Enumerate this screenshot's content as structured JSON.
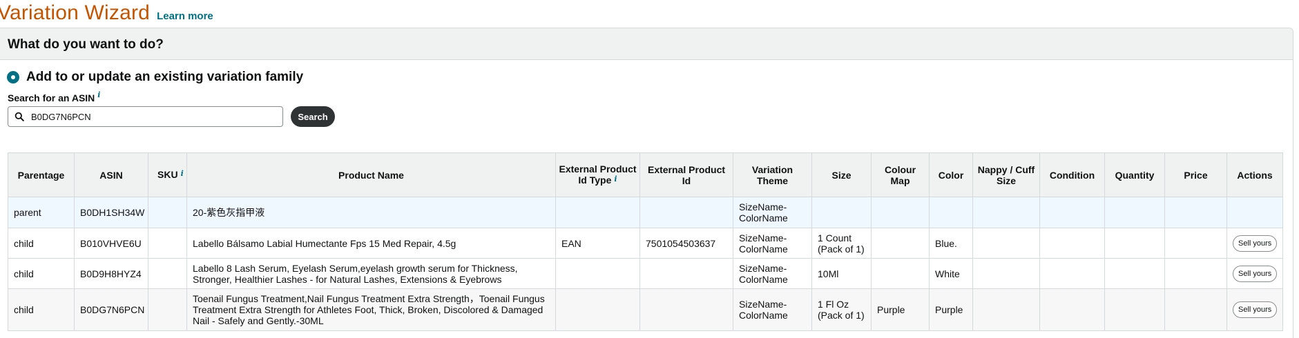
{
  "header": {
    "title": "Variation Wizard",
    "learn_more": "Learn more"
  },
  "section": {
    "question": "What do you want to do?",
    "option_label": "Add to or update an existing variation family"
  },
  "search": {
    "label": "Search for an ASIN",
    "info_icon": "i",
    "value": "B0DG7N6PCN",
    "button_label": "Search"
  },
  "table": {
    "columns": {
      "parentage": "Parentage",
      "asin": "ASIN",
      "sku": "SKU",
      "product_name": "Product Name",
      "ext_id_type": "External Product Id Type",
      "ext_id": "External Product Id",
      "variation_theme": "Variation Theme",
      "size": "Size",
      "colour_map": "Colour Map",
      "color": "Color",
      "nappy": "Nappy / Cuff Size",
      "condition": "Condition",
      "quantity": "Quantity",
      "price": "Price",
      "actions": "Actions"
    },
    "rows": [
      {
        "parentage": "parent",
        "asin": "B0DH1SH34W",
        "sku": "",
        "product_name": "20-紫色灰指甲液",
        "ext_id_type": "",
        "ext_id": "",
        "variation_theme": "SizeName-ColorName",
        "size": "",
        "colour_map": "",
        "color": "",
        "action": ""
      },
      {
        "parentage": "child",
        "asin": "B010VHVE6U",
        "sku": "",
        "product_name": "Labello Bálsamo Labial Humectante Fps 15 Med Repair, 4.5g",
        "ext_id_type": "EAN",
        "ext_id": "7501054503637",
        "variation_theme": "SizeName-ColorName",
        "size": "1 Count (Pack of 1)",
        "colour_map": "",
        "color": "Blue.",
        "action": "Sell yours"
      },
      {
        "parentage": "child",
        "asin": "B0D9H8HYZ4",
        "sku": "",
        "product_name": "Labello 8 Lash Serum, Eyelash Serum,eyelash growth serum for Thickness, Stronger, Healthier Lashes - for Natural Lashes, Extensions & Eyebrows",
        "ext_id_type": "",
        "ext_id": "",
        "variation_theme": "SizeName-ColorName",
        "size": "10Ml",
        "colour_map": "",
        "color": "White",
        "action": "Sell yours"
      },
      {
        "parentage": "child",
        "asin": "B0DG7N6PCN",
        "sku": "",
        "product_name": "Toenail Fungus Treatment,Nail Fungus Treatment Extra Strength，Toenail Fungus Treatment Extra Strength for Athletes Foot, Thick, Broken, Discolored & Damaged Nail - Safely and Gently.-30ML",
        "ext_id_type": "",
        "ext_id": "",
        "variation_theme": "SizeName-ColorName",
        "size": "1 Fl Oz (Pack of 1)",
        "colour_map": "Purple",
        "color": "Purple",
        "action": "Sell yours"
      }
    ]
  },
  "colors": {
    "title": "#c45500",
    "link": "#007185",
    "button_dark": "#303333",
    "header_bg": "#f0f2f2",
    "parent_row_bg": "#f0f8ff"
  },
  "icons": {
    "search": "magnifier-icon",
    "radio": "radio-selected-icon",
    "info": "info-icon"
  }
}
